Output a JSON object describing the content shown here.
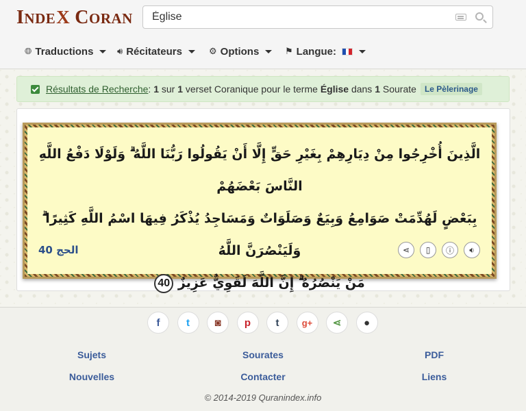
{
  "logo": {
    "text_part1_big": "I",
    "text_part1_small": "NDE",
    "cross": "X",
    "text_part2_big": "C",
    "text_part2_small": "ORAN"
  },
  "search": {
    "value": "Église",
    "placeholder": ""
  },
  "nav": [
    {
      "label": "Traductions",
      "icon": "globe-icon"
    },
    {
      "label": "Récitateurs",
      "icon": "speaker-icon"
    },
    {
      "label": "Options",
      "icon": "gear-icon"
    },
    {
      "label": "Langue:",
      "icon": "flag-icon"
    }
  ],
  "alert": {
    "link": "Résultats de Recherche",
    "colon": ":",
    "count1": "1",
    "text1": "sur",
    "count2": "1",
    "text2": "verset Coranique pour le terme",
    "term": "Église",
    "text3": "dans",
    "count3": "1",
    "text4": "Sourate",
    "tag": "Le Pèlerinage"
  },
  "verse": {
    "line1": "الَّذِينَ أُخْرِجُوا مِنْ دِيَارِهِمْ بِغَيْرِ حَقٍّ إِلَّا أَنْ يَقُولُوا رَبُّنَا اللَّهُ ۗ وَلَوْلَا دَفْعُ اللَّهِ النَّاسَ بَعْضَهُمْ",
    "line2": "بِبَعْضٍ لَهُدِّمَتْ صَوَامِعُ وَبِيَعٌ وَصَلَوَاتٌ وَمَسَاجِدُ يُذْكَرُ فِيهَا اسْمُ اللَّهِ كَثِيرًا ۗ وَلَيَنْصُرَنَّ اللَّهُ",
    "line3": "مَنْ يَنْصُرُهُ ۗ إِنَّ اللَّهَ لَقَوِيٌّ عَزِيزٌ",
    "number": "40",
    "reference": "الحج 40"
  },
  "footer": {
    "links": [
      "Sujets",
      "Sourates",
      "PDF",
      "Nouvelles",
      "Contacter",
      "Liens"
    ],
    "copyright": "© 2014-2019 Quranindex.info"
  },
  "social": [
    {
      "name": "facebook",
      "glyph": "f",
      "color": "#3b5998"
    },
    {
      "name": "twitter",
      "glyph": "t",
      "color": "#1da1f2"
    },
    {
      "name": "instagram",
      "glyph": "◙",
      "color": "#8a3a2a"
    },
    {
      "name": "pinterest",
      "glyph": "p",
      "color": "#c8232c"
    },
    {
      "name": "tumblr",
      "glyph": "t",
      "color": "#35465c"
    },
    {
      "name": "google-plus",
      "glyph": "g+",
      "color": "#dd4b39"
    },
    {
      "name": "share",
      "glyph": "⋖",
      "color": "#5a9a4a"
    },
    {
      "name": "github",
      "glyph": "●",
      "color": "#333333"
    }
  ]
}
